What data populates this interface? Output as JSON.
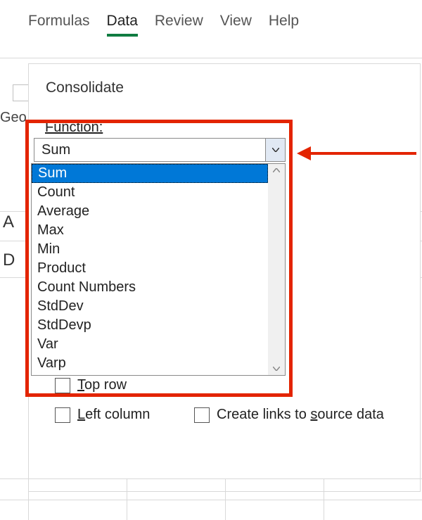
{
  "ribbon": {
    "tabs": {
      "formulas": "Formulas",
      "data": "Data",
      "review": "Review",
      "view": "View",
      "help": "Help"
    },
    "active_tab": "Data"
  },
  "background": {
    "truncated_word": "Geo",
    "row_a": "A",
    "row_d": "D"
  },
  "dialog": {
    "title": "Consolidate",
    "function_label": "Function:",
    "function_selected": "Sum",
    "function_options": [
      "Sum",
      "Count",
      "Average",
      "Max",
      "Min",
      "Product",
      "Count Numbers",
      "StdDev",
      "StdDevp",
      "Var",
      "Varp"
    ],
    "checkboxes": {
      "top_row": "Top row",
      "left_column": "Left column",
      "create_links": "Create links to source data"
    }
  },
  "annotation": {
    "red_box": true,
    "arrow_points_to": "function-dropdown"
  }
}
